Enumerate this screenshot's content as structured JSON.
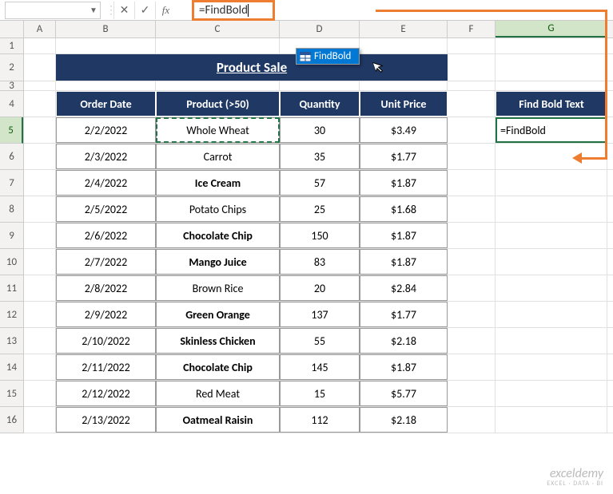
{
  "formula_bar": {
    "name_box": "",
    "cancel": "✕",
    "enter": "✓",
    "fx": "fx",
    "formula": "=FindBold"
  },
  "columns": [
    "A",
    "B",
    "C",
    "D",
    "E",
    "F",
    "G"
  ],
  "row_numbers": [
    "1",
    "2",
    "3",
    "4",
    "5",
    "6",
    "7",
    "8",
    "9",
    "10",
    "11",
    "12",
    "13",
    "14",
    "15",
    "16"
  ],
  "selected_col": "G",
  "selected_row": "5",
  "autocomplete": {
    "item": "FindBold"
  },
  "title": "Product Sale",
  "headers": {
    "order_date": "Order Date",
    "product": "Product (>50)",
    "quantity": "Quantity",
    "unit_price": "Unit Price"
  },
  "side": {
    "header": "Find Bold Text",
    "g5": "=FindBold"
  },
  "chart_data": {
    "type": "table",
    "columns": [
      "Order Date",
      "Product (>50)",
      "Quantity",
      "Unit Price"
    ],
    "rows": [
      {
        "date": "2/2/2022",
        "product": "Whole Wheat",
        "qty": "30",
        "price": "$3.49",
        "bold": false
      },
      {
        "date": "2/3/2022",
        "product": "Carrot",
        "qty": "35",
        "price": "$1.77",
        "bold": false
      },
      {
        "date": "2/4/2022",
        "product": "Ice Cream",
        "qty": "57",
        "price": "$1.87",
        "bold": true
      },
      {
        "date": "2/5/2022",
        "product": "Potato Chips",
        "qty": "25",
        "price": "$1.68",
        "bold": false
      },
      {
        "date": "2/6/2022",
        "product": "Chocolate Chip",
        "qty": "150",
        "price": "$1.87",
        "bold": true
      },
      {
        "date": "2/7/2022",
        "product": "Mango Juice",
        "qty": "83",
        "price": "$1.87",
        "bold": true
      },
      {
        "date": "2/8/2022",
        "product": "Brown Rice",
        "qty": "20",
        "price": "$2.84",
        "bold": false
      },
      {
        "date": "2/9/2022",
        "product": "Green Orange",
        "qty": "137",
        "price": "$1.77",
        "bold": true
      },
      {
        "date": "2/10/2022",
        "product": "Skinless Chicken",
        "qty": "55",
        "price": "$2.18",
        "bold": true
      },
      {
        "date": "2/11/2022",
        "product": "Chocolate Chip",
        "qty": "145",
        "price": "$1.87",
        "bold": true
      },
      {
        "date": "2/12/2022",
        "product": "Red Meat",
        "qty": "15",
        "price": "$5.77",
        "bold": false
      },
      {
        "date": "2/13/2022",
        "product": "Oatmeal Raisin",
        "qty": "112",
        "price": "$2.18",
        "bold": true
      }
    ]
  },
  "watermark": {
    "main": "exceldemy",
    "sub": "EXCEL · DATA · BI"
  }
}
